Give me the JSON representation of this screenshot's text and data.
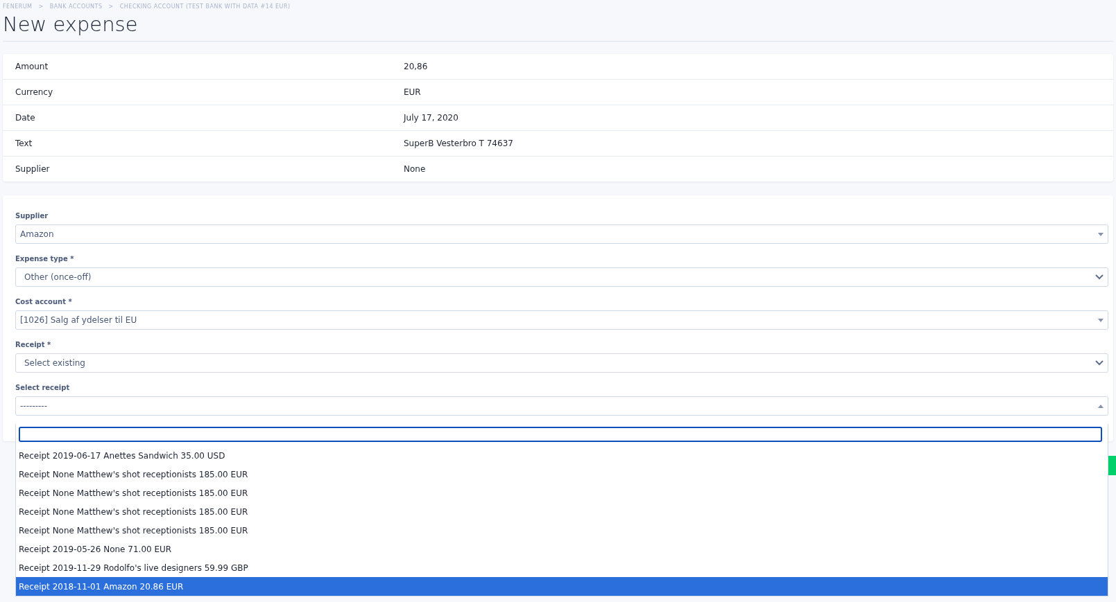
{
  "breadcrumb": [
    "FENERUM",
    "BANK ACCOUNTS",
    "CHECKING ACCOUNT (TEST BANK WITH DATA #14 EUR)"
  ],
  "breadcrumb_separator": ">",
  "title": "New expense",
  "details": [
    {
      "label": "Amount",
      "value": "20,86"
    },
    {
      "label": "Currency",
      "value": "EUR"
    },
    {
      "label": "Date",
      "value": "July 17, 2020"
    },
    {
      "label": "Text",
      "value": "SuperB Vesterbro T 74637"
    },
    {
      "label": "Supplier",
      "value": "None"
    }
  ],
  "form": [
    {
      "label": "Supplier",
      "kind": "search-select",
      "value": "Amazon",
      "open": false
    },
    {
      "label": "Expense type *",
      "kind": "native-select",
      "value": "Other (once-off)"
    },
    {
      "label": "Cost account *",
      "kind": "search-select",
      "value": "[1026] Salg af ydelser til EU",
      "open": false
    },
    {
      "label": "Receipt *",
      "kind": "native-select",
      "value": "Select existing"
    },
    {
      "label": "Select receipt",
      "kind": "search-select",
      "value": "---------",
      "open": true
    }
  ],
  "receipt_options": [
    {
      "label": "Receipt 2019-06-17 Anettes Sandwich 35.00 USD",
      "selected": false
    },
    {
      "label": "Receipt None Matthew's shot receptionists 185.00 EUR",
      "selected": false
    },
    {
      "label": "Receipt None Matthew's shot receptionists 185.00 EUR",
      "selected": false
    },
    {
      "label": "Receipt None Matthew's shot receptionists 185.00 EUR",
      "selected": false
    },
    {
      "label": "Receipt None Matthew's shot receptionists 185.00 EUR",
      "selected": false
    },
    {
      "label": "Receipt 2019-05-26 None 71.00 EUR",
      "selected": false
    },
    {
      "label": "Receipt 2019-11-29 Rodolfo's live designers 59.99 GBP",
      "selected": false
    },
    {
      "label": "Receipt 2018-11-01 Amazon 20.86 EUR",
      "selected": true
    }
  ]
}
